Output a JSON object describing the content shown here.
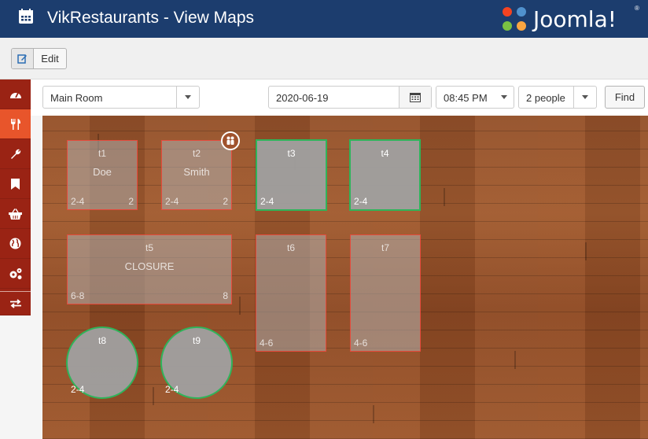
{
  "header": {
    "title": "VikRestaurants - View Maps",
    "logo_text": "Joomla!",
    "logo_reg": "®"
  },
  "toolbar": {
    "edit_label": "Edit"
  },
  "sidebar": {
    "items": [
      {
        "icon": "dashboard-icon"
      },
      {
        "icon": "utensils-icon",
        "active": true
      },
      {
        "icon": "wrench-icon"
      },
      {
        "icon": "bookmark-icon"
      },
      {
        "icon": "basket-icon"
      },
      {
        "icon": "globe-icon"
      },
      {
        "icon": "cogs-icon"
      },
      {
        "icon": "exchange-icon"
      }
    ]
  },
  "filters": {
    "room": "Main Room",
    "date": "2020-06-19",
    "time": "08:45 PM",
    "people": "2 people",
    "find_label": "Find"
  },
  "colors": {
    "header_bg": "#1c3d6e",
    "sidebar_bg": "#9a2314",
    "sidebar_active": "#e8552b",
    "reserved_border": "#e64a3c",
    "available_border": "#2fb45a"
  },
  "tables": [
    {
      "name": "t1",
      "occupant": "Doe",
      "capacity": "2-4",
      "count": "2",
      "status": "reserved"
    },
    {
      "name": "t2",
      "occupant": "Smith",
      "capacity": "2-4",
      "count": "2",
      "status": "reserved"
    },
    {
      "name": "t3",
      "occupant": "",
      "capacity": "2-4",
      "count": "",
      "status": "available"
    },
    {
      "name": "t4",
      "occupant": "",
      "capacity": "2-4",
      "count": "",
      "status": "available"
    },
    {
      "name": "t5",
      "occupant": "CLOSURE",
      "capacity": "6-8",
      "count": "8",
      "status": "reserved"
    },
    {
      "name": "t6",
      "occupant": "",
      "capacity": "4-6",
      "count": "",
      "status": "reserved"
    },
    {
      "name": "t7",
      "occupant": "",
      "capacity": "4-6",
      "count": "",
      "status": "reserved"
    },
    {
      "name": "t8",
      "occupant": "",
      "capacity": "2-4",
      "count": "",
      "status": "available"
    },
    {
      "name": "t9",
      "occupant": "",
      "capacity": "2-4",
      "count": "",
      "status": "available"
    }
  ]
}
